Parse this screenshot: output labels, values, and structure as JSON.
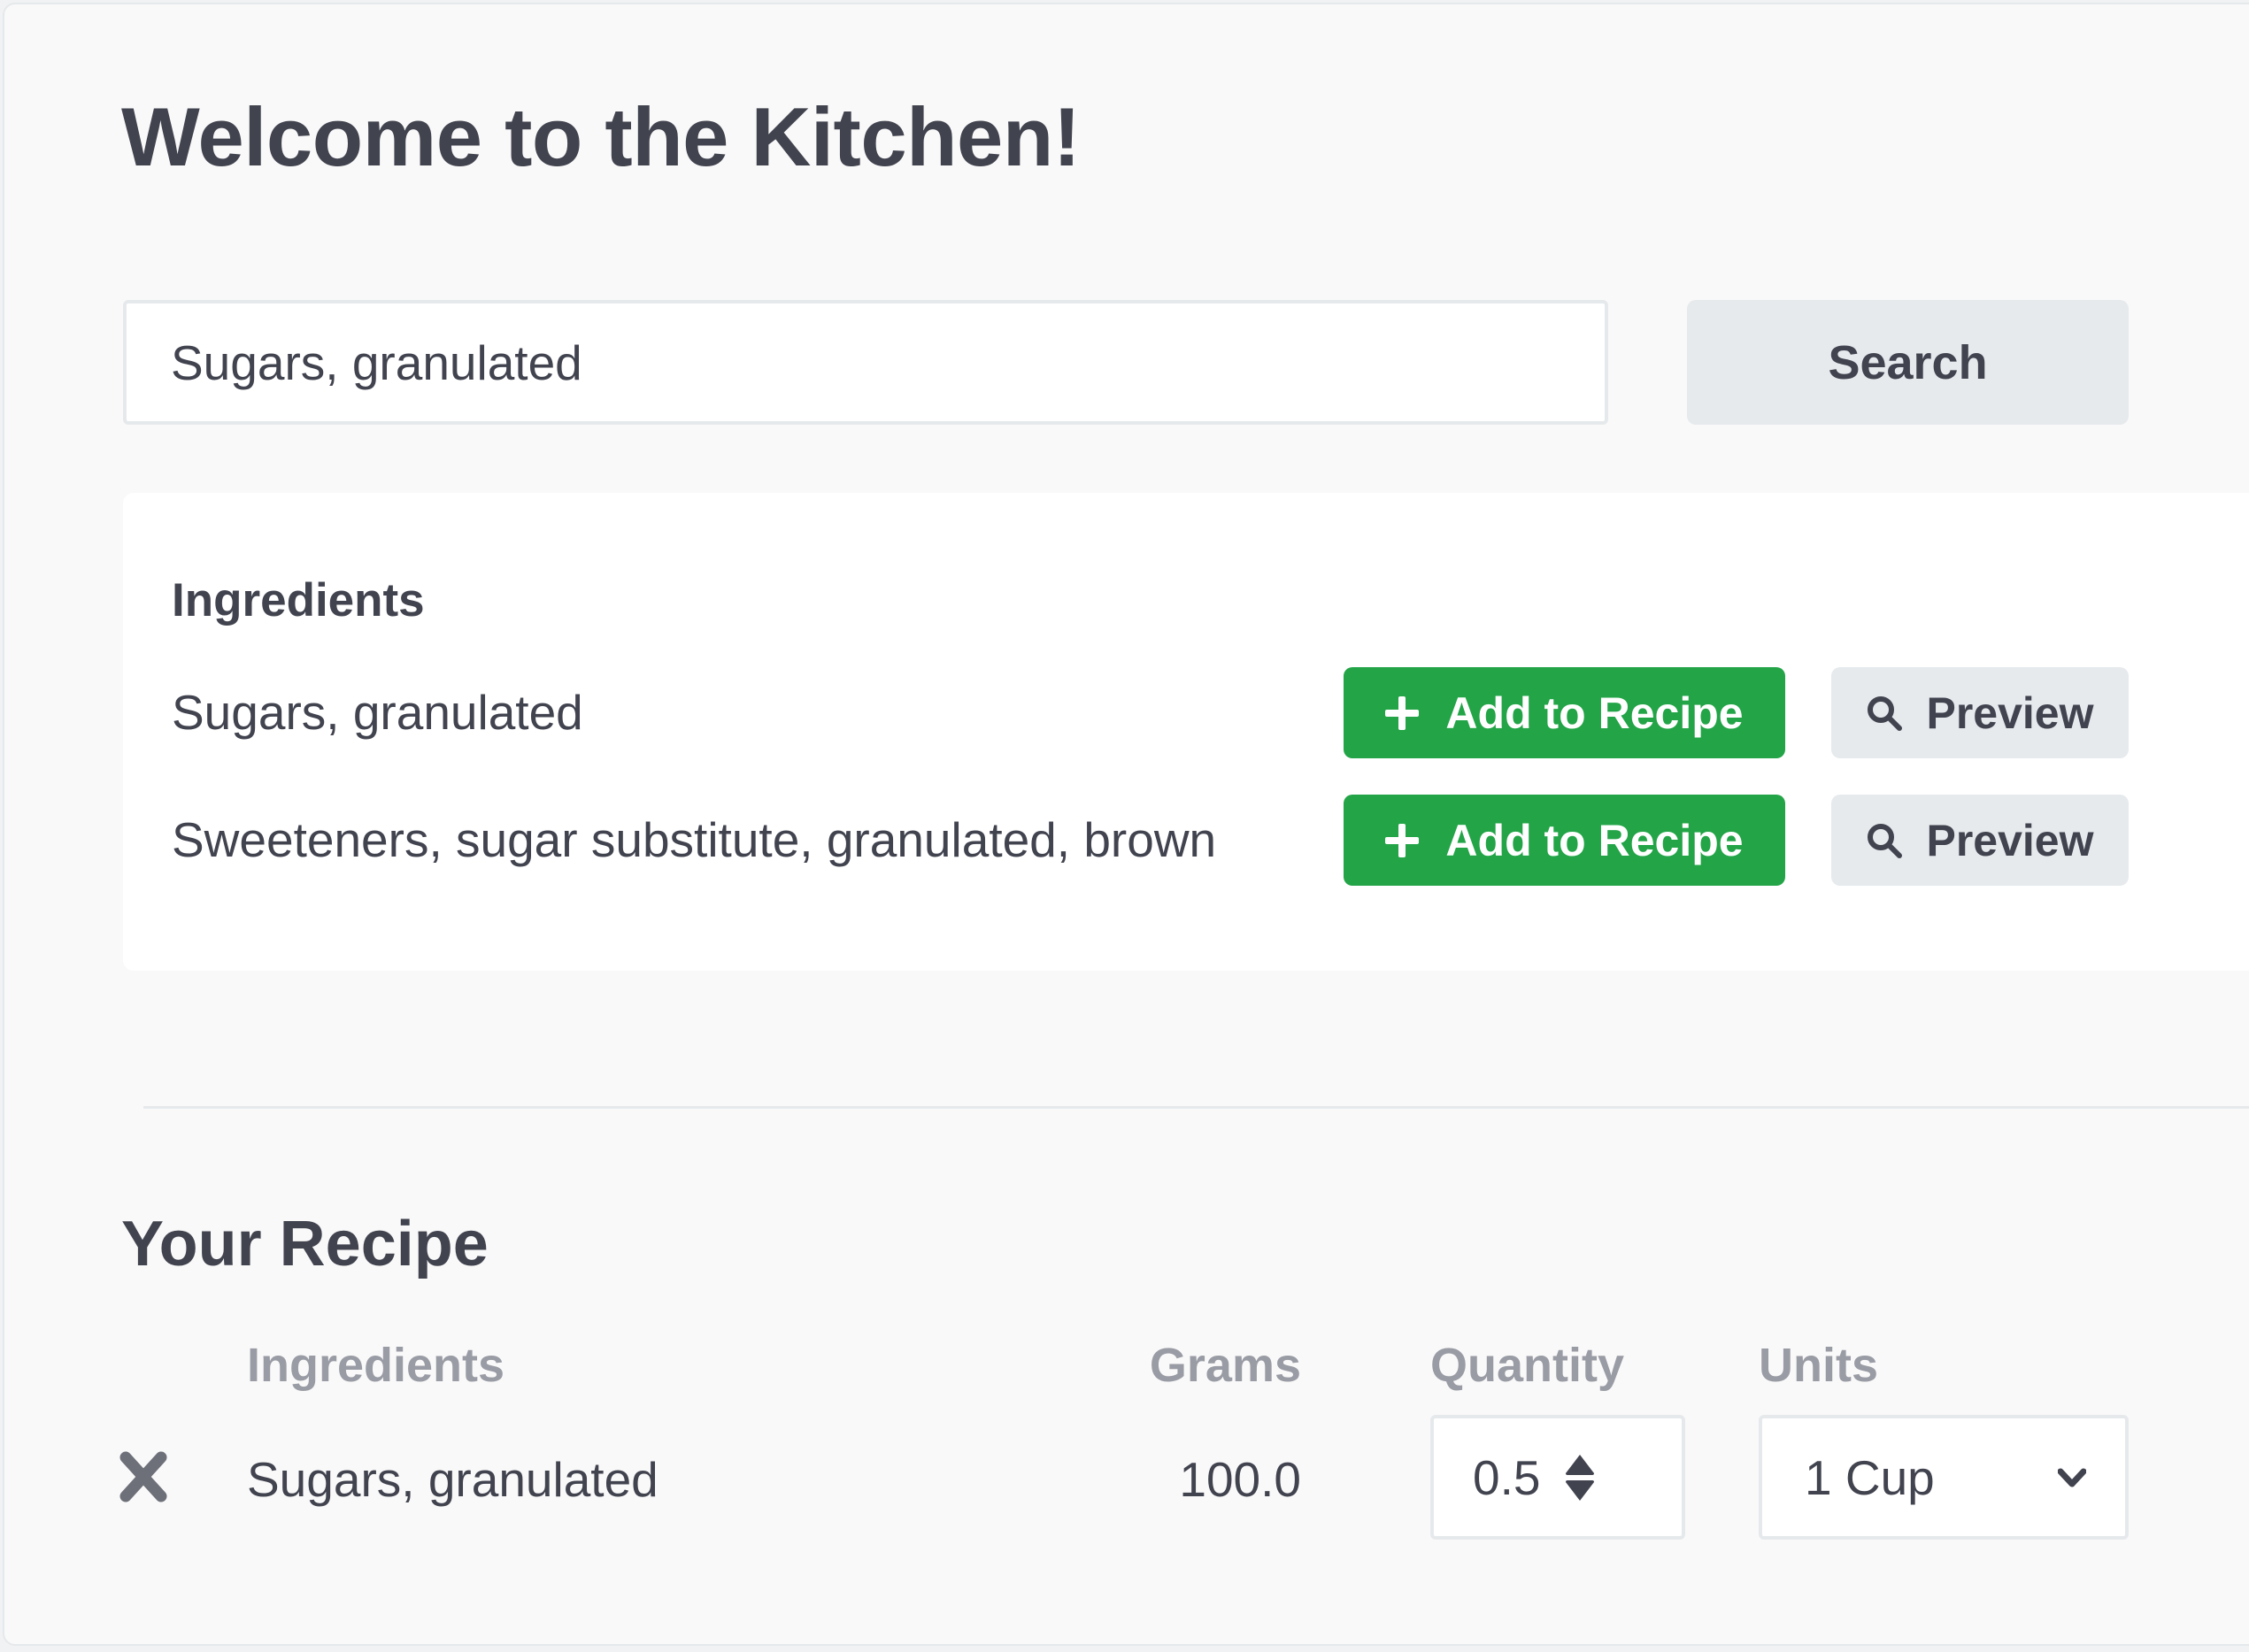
{
  "page": {
    "title": "Welcome to the Kitchen!"
  },
  "search": {
    "value": "Sugars, granulated",
    "button_label": "Search"
  },
  "results": {
    "heading": "Ingredients",
    "items": [
      {
        "name": "Sugars, granulated",
        "add_label": "Add to Recipe",
        "preview_label": "Preview"
      },
      {
        "name": "Sweeteners, sugar substitute, granulated, brown",
        "add_label": "Add to Recipe",
        "preview_label": "Preview"
      }
    ]
  },
  "recipe": {
    "title": "Your Recipe",
    "columns": {
      "ingredients": "Ingredients",
      "grams": "Grams",
      "quantity": "Quantity",
      "units": "Units"
    },
    "rows": [
      {
        "ingredient": "Sugars, granulated",
        "grams": "100.0",
        "quantity": "0.5",
        "unit": "1 Cup"
      }
    ]
  },
  "colors": {
    "primary_green": "#22a447",
    "secondary_button": "#e6eaed",
    "text": "#41434f",
    "muted_text": "#9a9ca5"
  }
}
